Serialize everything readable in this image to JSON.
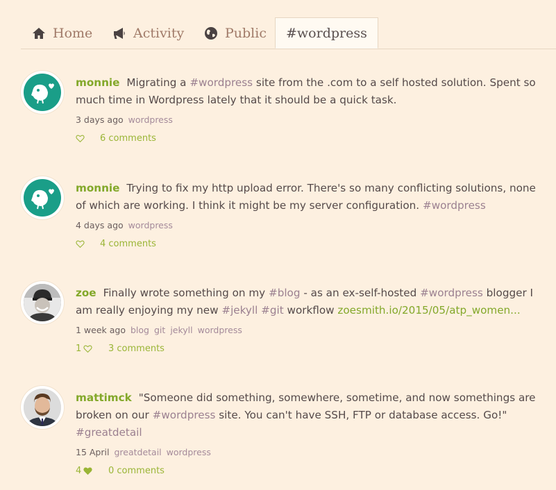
{
  "nav": {
    "tabs": [
      {
        "label": "Home",
        "icon": "home-icon"
      },
      {
        "label": "Activity",
        "icon": "megaphone-icon"
      },
      {
        "label": "Public",
        "icon": "globe-icon"
      },
      {
        "label": "#wordpress",
        "active": true
      }
    ]
  },
  "colors": {
    "background": "#fdf0e0",
    "accent": "#83a82a",
    "tag": "#9b8090",
    "avatar_teal": "#1a9e88"
  },
  "posts": [
    {
      "user": "monnie",
      "avatar": "bird-avatar",
      "text_before": "Migrating a ",
      "hashtag1": "#wordpress",
      "text_after": " site from the .com to a self hosted solution. Spent so much time in Wordpress lately that it should be a quick task.",
      "time": "3 days ago",
      "tags": [
        "wordpress"
      ],
      "likes": "",
      "liked": false,
      "comments": "6 comments"
    },
    {
      "user": "monnie",
      "avatar": "bird-avatar",
      "text_before": "Trying to fix my http upload error. There's so many conflicting solutions, none of which are working. I think it might be my server configuration. ",
      "hashtag1": "#wordpress",
      "text_after": "",
      "time": "4 days ago",
      "tags": [
        "wordpress"
      ],
      "likes": "",
      "liked": false,
      "comments": "4 comments"
    },
    {
      "user": "zoe",
      "avatar": "photo-avatar",
      "text_before": "Finally wrote something on my ",
      "hashtag1": "#blog",
      "text_mid1": " - as an ex-self-hosted ",
      "hashtag2": "#wordpress",
      "text_mid2": " blogger I am really enjoying my new ",
      "hashtag3": "#jekyll",
      "text_mid3": " ",
      "hashtag4": "#git",
      "text_mid4": " workflow ",
      "link": "zoesmith.io/2015/05/atp_women...",
      "time": "1 week ago",
      "tags": [
        "blog",
        "git",
        "jekyll",
        "wordpress"
      ],
      "likes": "1",
      "liked": false,
      "comments": "3 comments"
    },
    {
      "user": "mattimck",
      "avatar": "photo-avatar",
      "text_before": "\"Someone did something, somewhere, sometime, and now somethings are broken on our ",
      "hashtag1": "#wordpress",
      "text_mid1": " site. You can't have SSH, FTP or database access. Go!\" ",
      "hashtag2": "#greatdetail",
      "time": "15 April",
      "tags": [
        "greatdetail",
        "wordpress"
      ],
      "likes": "4",
      "liked": true,
      "comments": "0 comments"
    }
  ]
}
